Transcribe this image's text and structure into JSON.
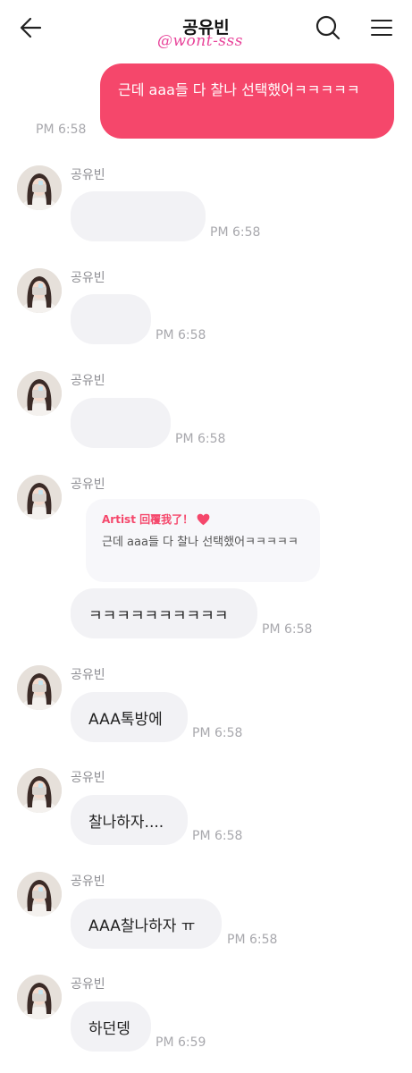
{
  "header": {
    "title": "공유빈",
    "watermark": "@wont-sss"
  },
  "sent": {
    "text": "근데 aaa들 다 찰나 선택했어ㅋㅋㅋㅋㅋ",
    "time": "PM 6:58"
  },
  "messages": [
    {
      "sender": "공유빈",
      "text": "",
      "time": "PM 6:58"
    },
    {
      "sender": "공유빈",
      "text": "",
      "time": "PM 6:58"
    },
    {
      "sender": "공유빈",
      "text": "",
      "time": "PM 6:58"
    },
    {
      "sender": "공유빈",
      "text": "ㅋㅋㅋㅋㅋㅋㅋㅋㅋㅋ",
      "time": "PM 6:58",
      "reply": {
        "label": "Artist 回覆我了！",
        "quote": "근데 aaa들 다 찰나 선택했어ㅋㅋㅋㅋㅋ"
      }
    },
    {
      "sender": "공유빈",
      "text": "AAA톡방에",
      "time": "PM 6:58"
    },
    {
      "sender": "공유빈",
      "text": "찰나하자....",
      "time": "PM 6:58"
    },
    {
      "sender": "공유빈",
      "text": "AAA찰나하자 ㅠ",
      "time": "PM 6:58"
    },
    {
      "sender": "공유빈",
      "text": "하던뎅",
      "time": "PM 6:59"
    }
  ],
  "colors": {
    "accent": "#f5476b",
    "received_bubble": "#f2f2f5",
    "watermark": "#e8449a"
  },
  "icons": [
    "back-arrow-icon",
    "search-icon",
    "menu-icon",
    "heart-icon"
  ]
}
